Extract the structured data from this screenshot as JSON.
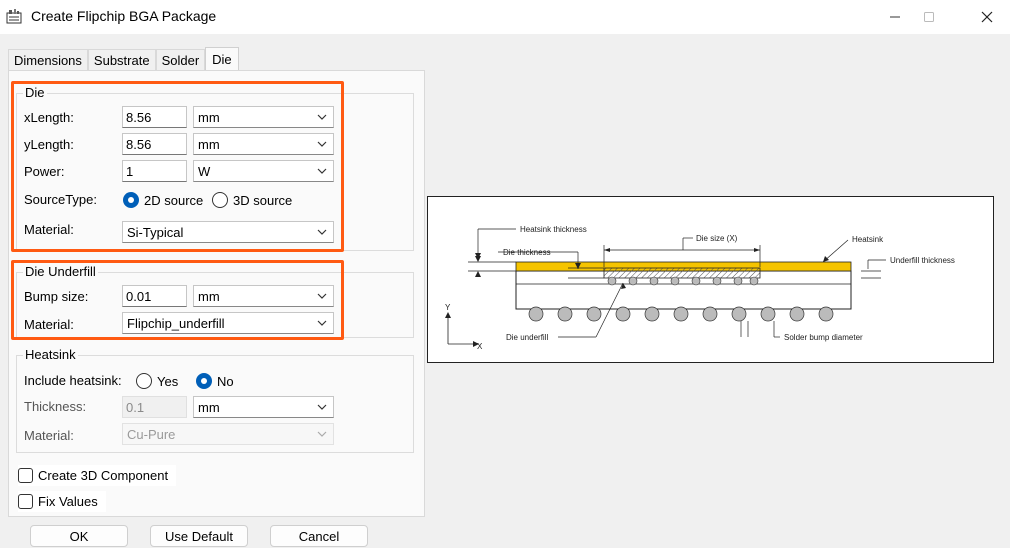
{
  "window": {
    "title": "Create Flipchip BGA Package",
    "minimize": "—",
    "maximize": "☐",
    "close": "✕"
  },
  "tabs": [
    "Dimensions",
    "Substrate",
    "Solder",
    "Die"
  ],
  "active_tab": "Die",
  "die_group": {
    "title": "Die",
    "xlength": {
      "label": "xLength:",
      "value": "8.56",
      "unit": "mm"
    },
    "ylength": {
      "label": "yLength:",
      "value": "8.56",
      "unit": "mm"
    },
    "power": {
      "label": "Power:",
      "value": "1",
      "unit": "W"
    },
    "source_type": {
      "label": "SourceType:",
      "options": [
        "2D source",
        "3D source"
      ],
      "selected": "2D source"
    },
    "material": {
      "label": "Material:",
      "value": "Si-Typical"
    }
  },
  "underfill_group": {
    "title": "Die Underfill",
    "bump_size": {
      "label": "Bump size:",
      "value": "0.01",
      "unit": "mm"
    },
    "material": {
      "label": "Material:",
      "value": "Flipchip_underfill"
    }
  },
  "heatsink_group": {
    "title": "Heatsink",
    "include": {
      "label": "Include heatsink:",
      "options": [
        "Yes",
        "No"
      ],
      "selected": "No"
    },
    "thickness": {
      "label": "Thickness:",
      "value": "0.1",
      "unit": "mm"
    },
    "material": {
      "label": "Material:",
      "value": "Cu-Pure"
    }
  },
  "checkboxes": {
    "create_3d": "Create 3D Component",
    "fix_values": "Fix Values"
  },
  "buttons": {
    "ok": "OK",
    "use_default": "Use Default",
    "cancel": "Cancel"
  },
  "diagram": {
    "heatsink_thickness": "Heatsink thickness",
    "die_thickness": "Die thickness",
    "die_size": "Die size (X)",
    "heatsink": "Heatsink",
    "underfill_thickness": "Underfill thickness",
    "die_underfill": "Die underfill",
    "solder_bump_diameter": "Solder bump diameter",
    "axis_y": "Y",
    "axis_x": "X"
  },
  "colors": {
    "highlight": "#ff5a12",
    "radio_accent": "#005fb8",
    "heatsink_fill": "#f5c400"
  }
}
